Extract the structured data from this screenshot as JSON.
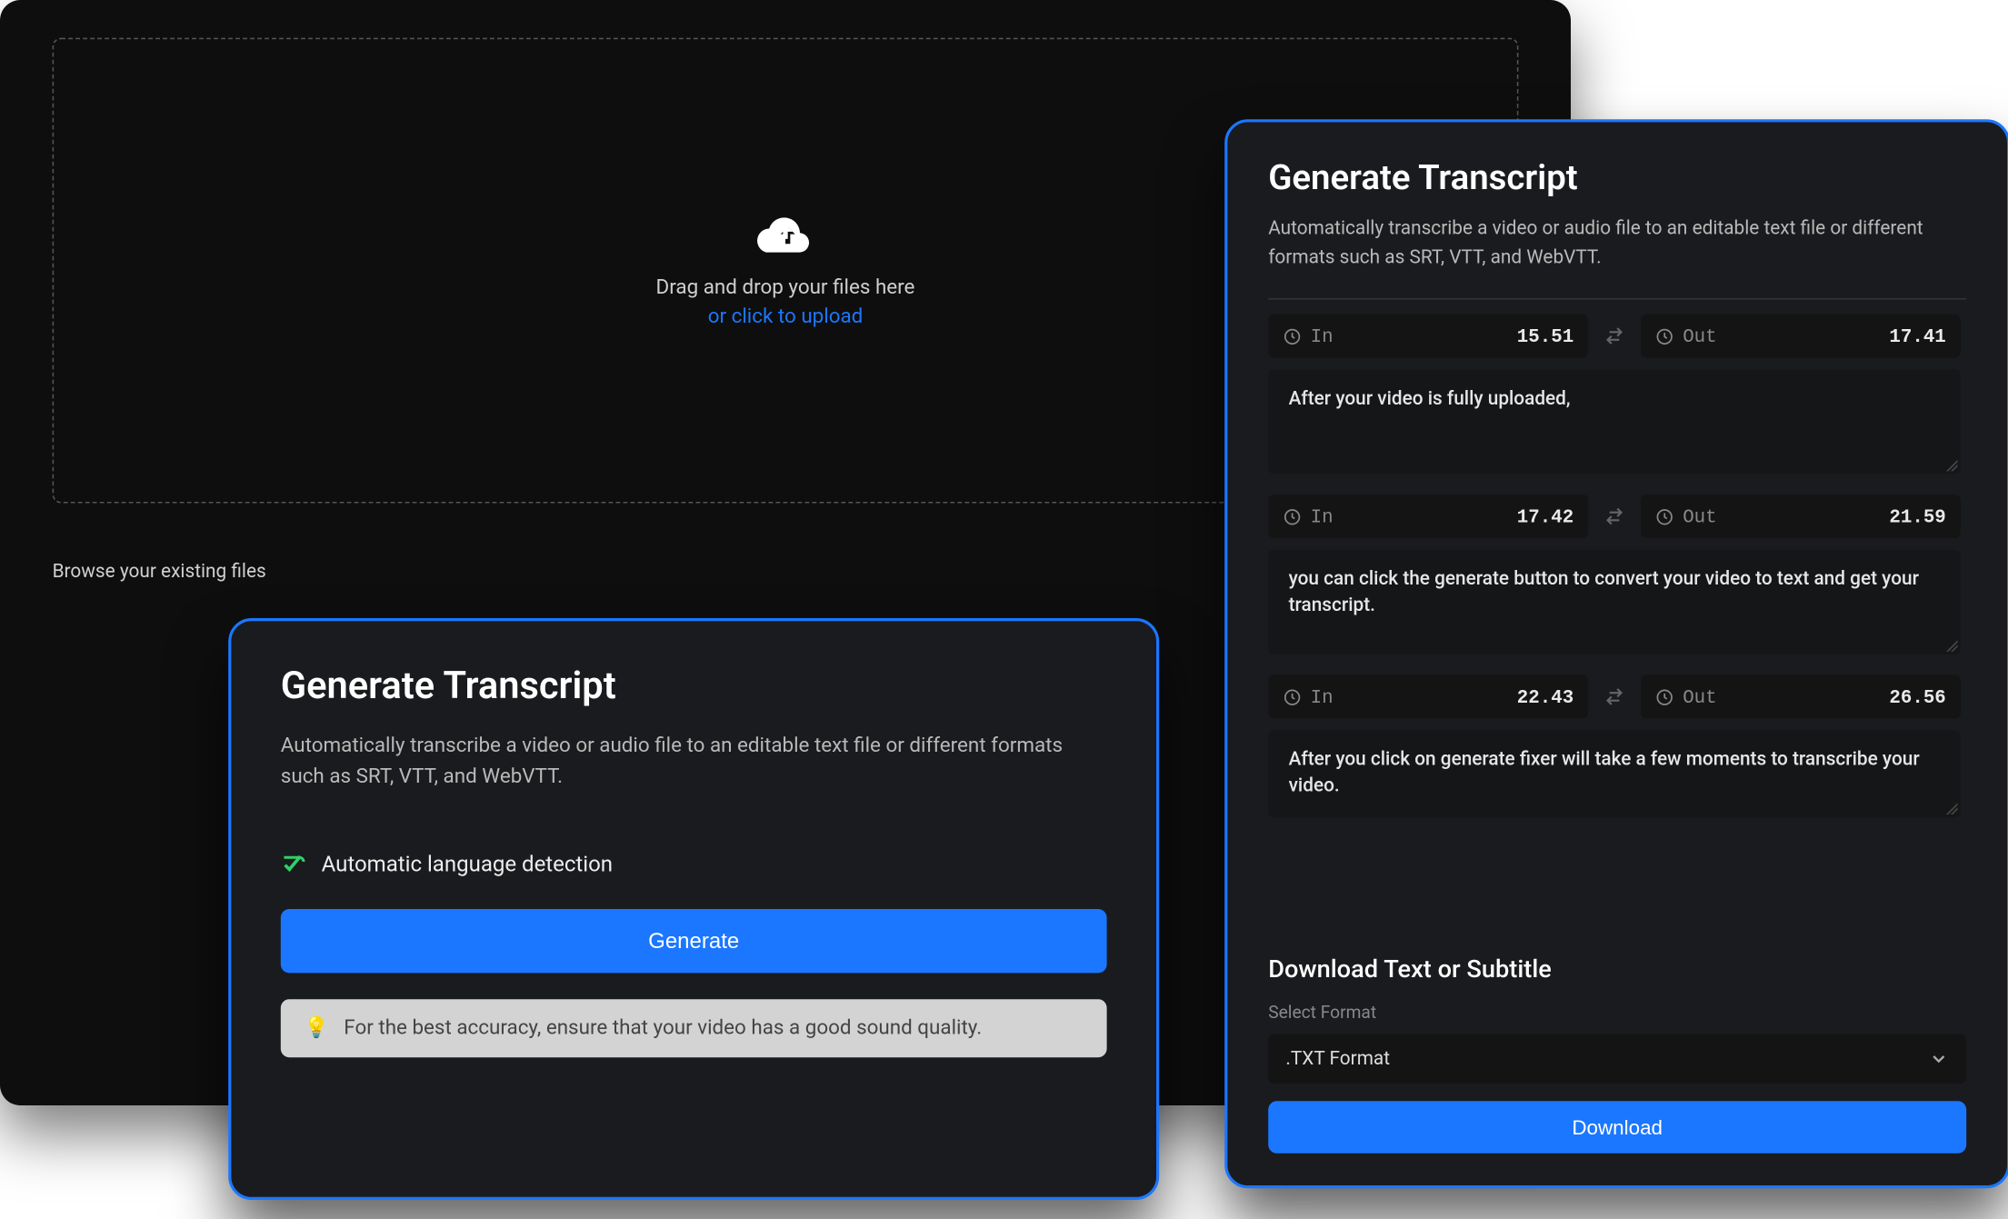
{
  "colors": {
    "accent": "#1b77ff",
    "success": "#2fcf68",
    "panel": "#1a1b1e",
    "back": "#0e0e0e"
  },
  "upload": {
    "drag_text": "Drag and drop your files here",
    "click_text": "or click to upload",
    "browse_label": "Browse your existing files"
  },
  "generate_panel": {
    "title": "Generate Transcript",
    "description": "Automatically transcribe a video or audio file to an editable text file or different formats such as SRT, VTT, and WebVTT.",
    "language_detection_label": "Automatic language detection",
    "generate_button": "Generate",
    "tip_text": "For the best accuracy, ensure that your video has a good sound quality."
  },
  "results_panel": {
    "title": "Generate Transcript",
    "description": "Automatically transcribe a video or audio file to an editable text file or different formats such as SRT, VTT, and WebVTT.",
    "in_label": "In",
    "out_label": "Out",
    "segments": [
      {
        "in": "15.51",
        "out": "17.41",
        "text": "After your video is fully uploaded,"
      },
      {
        "in": "17.42",
        "out": "21.59",
        "text": "you can click the generate button to convert your video to text and get your transcript."
      },
      {
        "in": "22.43",
        "out": "26.56",
        "text": "After you click on generate fixer will take a few moments to transcribe your video."
      }
    ],
    "download_heading": "Download Text or Subtitle",
    "select_format_label": "Select Format",
    "selected_format": ".TXT Format",
    "download_button": "Download"
  }
}
